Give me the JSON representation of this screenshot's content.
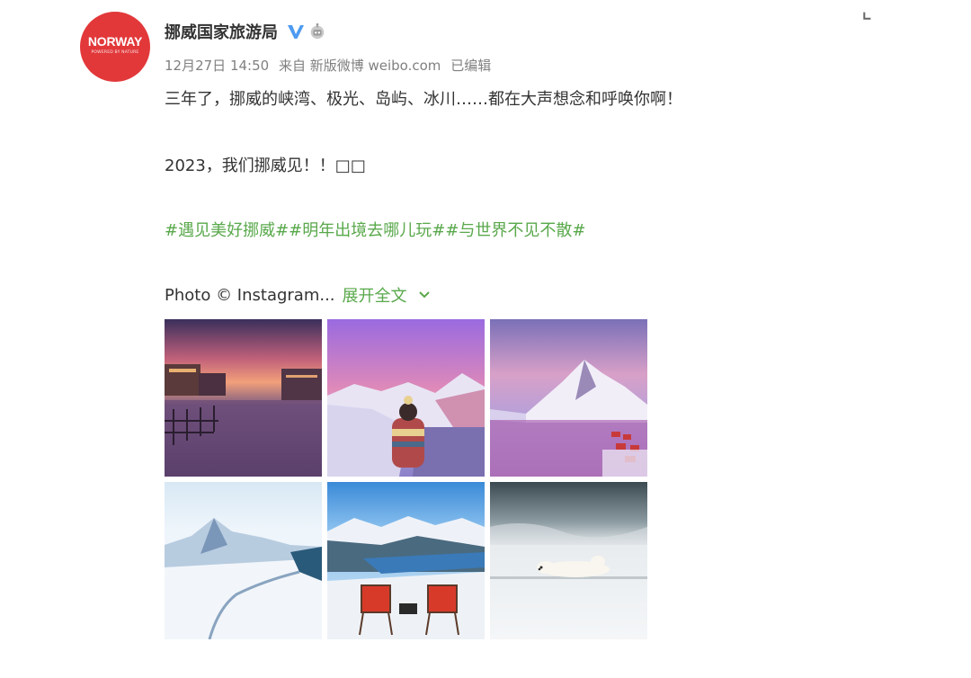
{
  "post": {
    "author": "挪威国家旅游局",
    "avatar": {
      "brand": "NORWAY",
      "tagline": "POWERED BY NATURE"
    },
    "meta": {
      "date": "12月27日 14:50",
      "source": "来自 新版微博 weibo.com",
      "edited": "已编辑"
    },
    "lines": [
      "三年了，挪威的峡湾、极光、岛屿、冰川……都在大声想念和呼唤你啊！",
      "2023，我们挪威见！！□□"
    ],
    "hashtags": [
      "#遇见美好挪威#",
      "#明年出境去哪儿玩#",
      "#与世界不见不散#"
    ],
    "photo_credit": "Photo © Instagram...",
    "expand_label": "展开全文",
    "photos": [
      "fjord-city-sunset",
      "person-on-mountain-snow",
      "lofoten-village-pink-sky",
      "snowy-mountain-valley",
      "deck-chairs-fjord-view",
      "polar-bear-on-ice"
    ]
  },
  "colors": {
    "accent_green": "#59a84b",
    "brand_red": "#e2383a",
    "verified_blue": "#4d9bf0",
    "meta_gray": "#808080"
  }
}
